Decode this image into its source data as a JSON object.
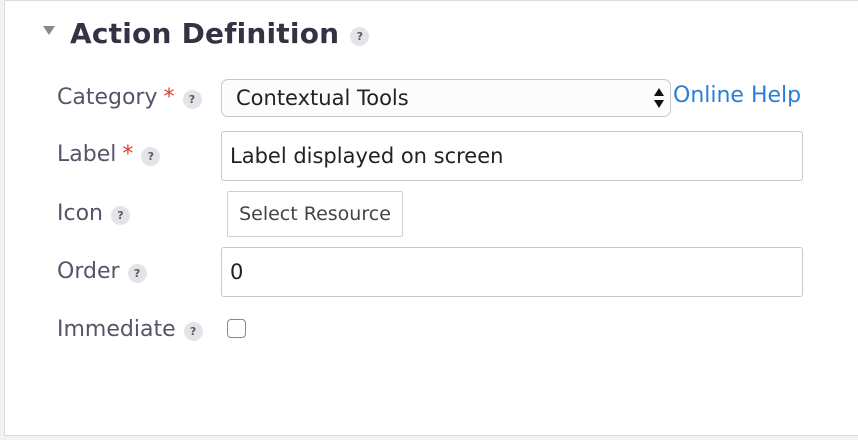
{
  "section": {
    "title": "Action Definition",
    "help": "?"
  },
  "fields": {
    "category": {
      "label": "Category",
      "required": "*",
      "help": "?",
      "value": "Contextual Tools",
      "link": "Online Help"
    },
    "label": {
      "label": "Label",
      "required": "*",
      "help": "?",
      "value": "Label displayed on screen"
    },
    "icon": {
      "label": "Icon",
      "help": "?",
      "button": "Select Resource"
    },
    "order": {
      "label": "Order",
      "help": "?",
      "value": "0"
    },
    "immediate": {
      "label": "Immediate",
      "help": "?",
      "checked": false
    }
  },
  "colors": {
    "title": "#333344",
    "label": "#55556a",
    "required": "#e23b2e",
    "link": "#2a7fd4"
  },
  "icons": {
    "collapse": "triangle-down-icon",
    "help": "question-mark-icon",
    "select": "up-down-arrows-icon"
  }
}
